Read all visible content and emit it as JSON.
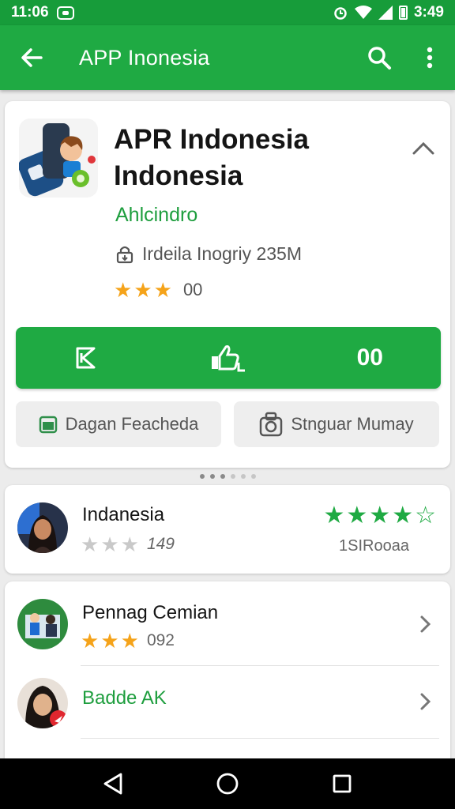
{
  "status_bar": {
    "time": "11:06",
    "clock_right": "3:49"
  },
  "app_bar": {
    "title": "APP Inonesia"
  },
  "app": {
    "name_line1": "APR Indonesia",
    "name_line2": "Indonesia",
    "developer": "Ahlcindro",
    "meta": "Irdeila Inogriy 235M",
    "rating_stars": 3,
    "rating_count": "00"
  },
  "install_bar": {
    "value": "00"
  },
  "secondary_buttons": {
    "left_label": "Dagan Feacheda",
    "right_label": "Stnguar Mumay"
  },
  "review": {
    "name": "Indanesia",
    "stars": 3,
    "count": "149",
    "rating": 4,
    "subtitle": "1SIRooaa"
  },
  "list": [
    {
      "name": "Pennag Cemian",
      "stars": 3,
      "count": "092"
    },
    {
      "name": "Badde AK"
    }
  ],
  "colors": {
    "primary": "#1faa43",
    "status": "#179c3a",
    "star": "#f5a31a"
  },
  "icons": [
    "back-icon",
    "search-icon",
    "more-vert-icon",
    "collapse-icon",
    "download-size-icon",
    "share-icon",
    "like-icon",
    "calendar-icon",
    "camera-icon",
    "chevron-right-icon",
    "nav-back-icon",
    "nav-home-icon",
    "nav-recents-icon"
  ]
}
